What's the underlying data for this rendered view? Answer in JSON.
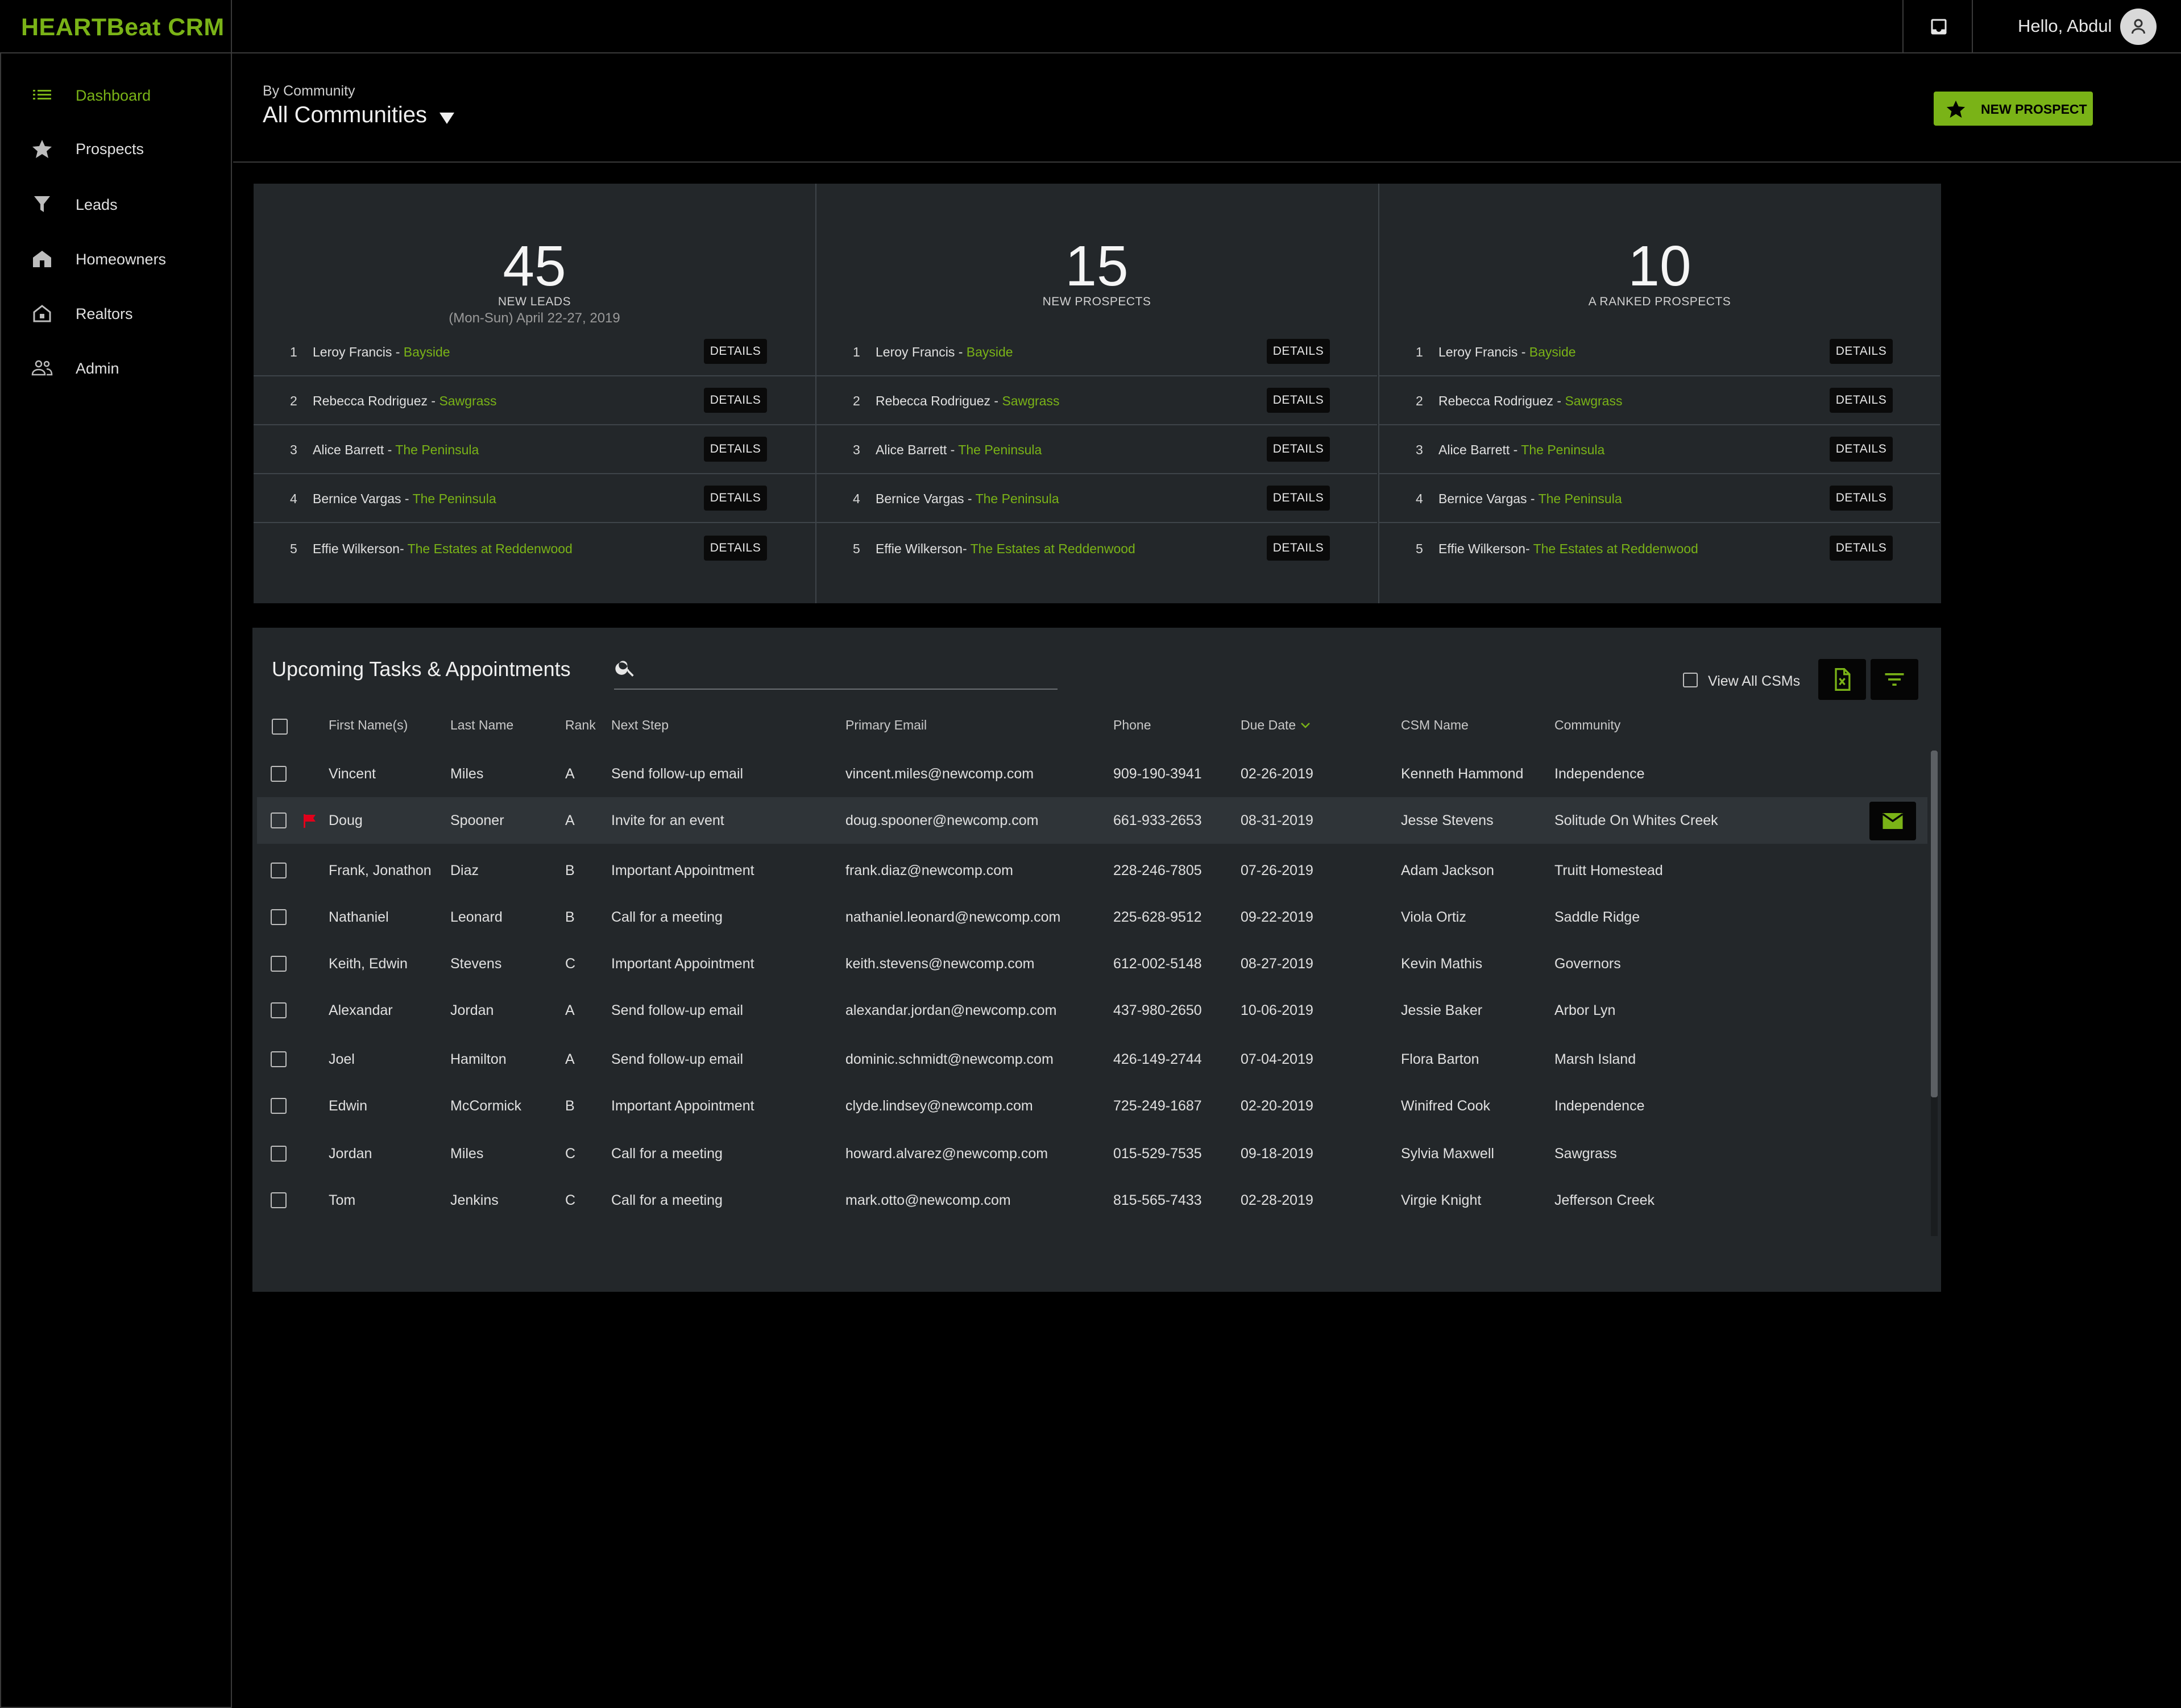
{
  "app": {
    "brand": "HEARTBeat CRM",
    "greeting": "Hello, Abdul"
  },
  "colors": {
    "accent": "#7ab317",
    "panel": "#23272a",
    "flag": "#e0001b"
  },
  "sidebar": {
    "items": [
      {
        "label": "Dashboard",
        "icon": "list-icon",
        "active": true
      },
      {
        "label": "Prospects",
        "icon": "star-icon"
      },
      {
        "label": "Leads",
        "icon": "funnel-icon"
      },
      {
        "label": "Homeowners",
        "icon": "house-icon"
      },
      {
        "label": "Realtors",
        "icon": "house-outline-icon"
      },
      {
        "label": "Admin",
        "icon": "people-icon"
      }
    ]
  },
  "filter": {
    "label": "By Community",
    "value": "All Communities"
  },
  "actions": {
    "new_prospect": "NEW PROSPECT"
  },
  "stats": [
    {
      "number": "45",
      "label": "NEW LEADS",
      "sub": "(Mon-Sun) April 22-27, 2019",
      "rows": [
        {
          "rank": "1",
          "name": "Leroy Francis - ",
          "community": "Bayside",
          "btn": "DETAILS"
        },
        {
          "rank": "2",
          "name": "Rebecca Rodriguez - ",
          "community": "Sawgrass",
          "btn": "DETAILS"
        },
        {
          "rank": "3",
          "name": "Alice Barrett - ",
          "community": "The Peninsula",
          "btn": "DETAILS"
        },
        {
          "rank": "4",
          "name": "Bernice Vargas - ",
          "community": "The Peninsula",
          "btn": "DETAILS"
        },
        {
          "rank": "5",
          "name": "Effie Wilkerson- ",
          "community": "The Estates at Reddenwood",
          "btn": "DETAILS"
        }
      ]
    },
    {
      "number": "15",
      "label": "NEW PROSPECTS",
      "sub": "",
      "rows": [
        {
          "rank": "1",
          "name": "Leroy Francis - ",
          "community": "Bayside",
          "btn": "DETAILS"
        },
        {
          "rank": "2",
          "name": "Rebecca Rodriguez - ",
          "community": "Sawgrass",
          "btn": "DETAILS"
        },
        {
          "rank": "3",
          "name": "Alice Barrett - ",
          "community": "The Peninsula",
          "btn": "DETAILS"
        },
        {
          "rank": "4",
          "name": "Bernice Vargas - ",
          "community": "The Peninsula",
          "btn": "DETAILS"
        },
        {
          "rank": "5",
          "name": "Effie Wilkerson- ",
          "community": "The Estates at Reddenwood",
          "btn": "DETAILS"
        }
      ]
    },
    {
      "number": "10",
      "label": "A RANKED PROSPECTS",
      "sub": "",
      "rows": [
        {
          "rank": "1",
          "name": "Leroy Francis - ",
          "community": "Bayside",
          "btn": "DETAILS"
        },
        {
          "rank": "2",
          "name": "Rebecca Rodriguez - ",
          "community": "Sawgrass",
          "btn": "DETAILS"
        },
        {
          "rank": "3",
          "name": "Alice Barrett - ",
          "community": "The Peninsula",
          "btn": "DETAILS"
        },
        {
          "rank": "4",
          "name": "Bernice Vargas - ",
          "community": "The Peninsula",
          "btn": "DETAILS"
        },
        {
          "rank": "5",
          "name": "Effie Wilkerson- ",
          "community": "The Estates at Reddenwood",
          "btn": "DETAILS"
        }
      ]
    }
  ],
  "tasks": {
    "title": "Upcoming Tasks & Appointments",
    "search_placeholder": "",
    "view_all_label": "View All CSMs",
    "columns": [
      "First Name(s)",
      "Last Name",
      "Rank",
      "Next Step",
      "Primary Email",
      "Phone",
      "Due Date",
      "CSM Name",
      "Community"
    ],
    "rows": [
      [
        "Vincent",
        "Miles",
        "A",
        "Send follow-up email",
        "vincent.miles@newcomp.com",
        "909-190-3941",
        "02-26-2019",
        "Kenneth Hammond",
        "Independence"
      ],
      [
        "Doug",
        "Spooner",
        "A",
        "Invite for an event",
        "doug.spooner@newcomp.com",
        "661-933-2653",
        "08-31-2019",
        "Jesse Stevens",
        "Solitude On Whites Creek"
      ],
      [
        "Frank, Jonathon",
        "Diaz",
        "B",
        "Important Appointment",
        "frank.diaz@newcomp.com",
        "228-246-7805",
        "07-26-2019",
        "Adam Jackson",
        "Truitt Homestead"
      ],
      [
        "Nathaniel",
        "Leonard",
        "B",
        "Call for a meeting",
        "nathaniel.leonard@newcomp.com",
        "225-628-9512",
        "09-22-2019",
        "Viola Ortiz",
        "Saddle Ridge"
      ],
      [
        "Keith, Edwin",
        "Stevens",
        "C",
        "Important Appointment",
        "keith.stevens@newcomp.com",
        "612-002-5148",
        "08-27-2019",
        "Kevin Mathis",
        "Governors"
      ],
      [
        "Alexandar",
        "Jordan",
        "A",
        "Send follow-up email",
        "alexandar.jordan@newcomp.com",
        "437-980-2650",
        "10-06-2019",
        "Jessie Baker",
        "Arbor Lyn"
      ],
      [
        "Joel",
        "Hamilton",
        "A",
        "Send follow-up email",
        "dominic.schmidt@newcomp.com",
        "426-149-2744",
        "07-04-2019",
        "Flora Barton",
        "Marsh Island"
      ],
      [
        "Edwin",
        "McCormick",
        "B",
        "Important Appointment",
        "clyde.lindsey@newcomp.com",
        "725-249-1687",
        "02-20-2019",
        "Winifred Cook",
        "Independence"
      ],
      [
        "Jordan",
        "Miles",
        "C",
        "Call for a meeting",
        "howard.alvarez@newcomp.com",
        "015-529-7535",
        "09-18-2019",
        "Sylvia Maxwell",
        "Sawgrass"
      ],
      [
        "Tom",
        "Jenkins",
        "C",
        "Call for a meeting",
        "mark.otto@newcomp.com",
        "815-565-7433",
        "02-28-2019",
        "Virgie Knight",
        "Jefferson Creek"
      ]
    ],
    "flagged_row": 1,
    "highlighted_row": 1
  }
}
